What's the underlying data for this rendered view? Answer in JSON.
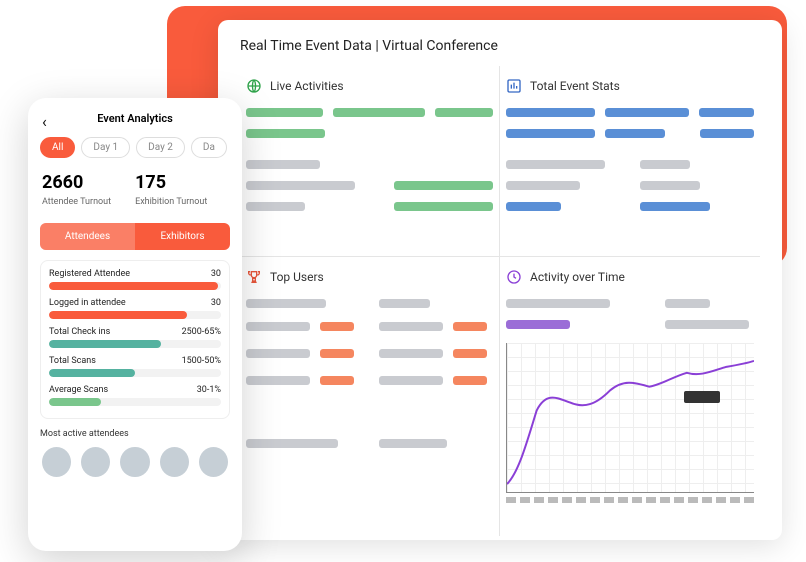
{
  "dashboard": {
    "title": "Real Time Event Data | Virtual Conference",
    "panels": {
      "live": "Live Activities",
      "stats": "Total Event Stats",
      "users": "Top Users",
      "activity": "Activity over Time"
    }
  },
  "mobile": {
    "title": "Event Analytics",
    "filters": [
      "All",
      "Day 1",
      "Day 2",
      "Da"
    ],
    "active_filter": 0,
    "stats": [
      {
        "value": "2660",
        "label": "Attendee Turnout"
      },
      {
        "value": "175",
        "label": "Exhibition Turnout"
      }
    ],
    "segments": [
      "Attendees",
      "Exhibitors"
    ],
    "active_segment": 0,
    "metrics": [
      {
        "label": "Registered Attendee",
        "value": "30",
        "fill": 98,
        "color": "#f95b3c"
      },
      {
        "label": "Logged in attendee",
        "value": "30",
        "fill": 80,
        "color": "#f95b3c"
      },
      {
        "label": "Total Check ins",
        "value": "2500-65%",
        "fill": 65,
        "color": "#55b2a0"
      },
      {
        "label": "Total Scans",
        "value": "1500-50%",
        "fill": 50,
        "color": "#55b2a0"
      },
      {
        "label": "Average Scans",
        "value": "30-1%",
        "fill": 30,
        "color": "#7ac68c"
      }
    ],
    "most_label": "Most active attendees"
  },
  "chart_data": {
    "type": "line",
    "title": "Activity over Time",
    "x": [
      0,
      1,
      2,
      3,
      4,
      5,
      6,
      7,
      8,
      9,
      10,
      11,
      12,
      13,
      14,
      15,
      16,
      17
    ],
    "values": [
      5,
      28,
      55,
      62,
      60,
      56,
      58,
      68,
      75,
      74,
      70,
      72,
      76,
      80,
      78,
      82,
      84,
      86
    ],
    "ylim": [
      0,
      100
    ]
  },
  "colors": {
    "accent": "#f95b3c",
    "green": "#7ac68c",
    "blue": "#5a8fd6",
    "orange": "#f5865f",
    "purple": "#9b6dd7",
    "teal": "#55b2a0"
  }
}
